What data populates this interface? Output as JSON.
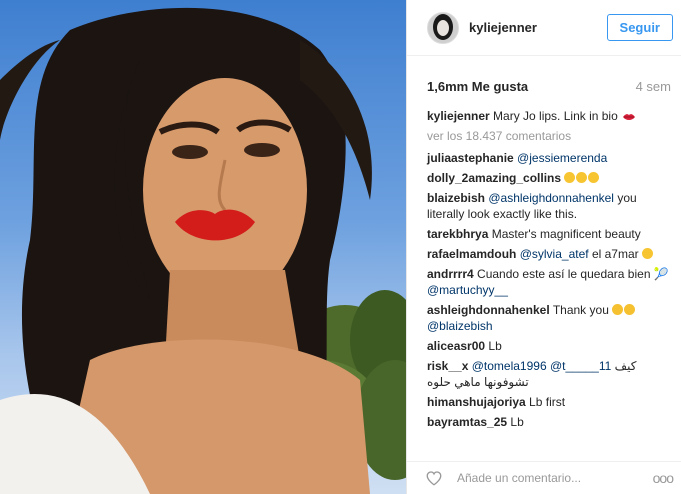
{
  "post": {
    "username": "kyliejenner",
    "follow_label": "Seguir",
    "likes": "1,6mm Me gusta",
    "age": "4 sem",
    "caption_user": "kyliejenner",
    "caption_text": "Mary Jo lips. Link in bio",
    "view_all": "ver los 18.437 comentarios"
  },
  "comments": [
    {
      "user": "juliaastephanie",
      "mention": "@jessiemerenda"
    },
    {
      "user": "dolly_2amazing_collins",
      "emoji_count": 3
    },
    {
      "user": "blaizebish",
      "mention": "@ashleighdonnahenkel",
      "text": "you literally look exactly like this."
    },
    {
      "user": "tarekbhrya",
      "text": "Master's magnificent beauty"
    },
    {
      "user": "rafaelmamdouh",
      "mention": "@sylvia_atef",
      "text": "el a7mar"
    },
    {
      "user": "andrrrr4",
      "text": "Cuando este así le quedara bien",
      "text2": "🎾",
      "mention": "@martuchyy__"
    },
    {
      "user": "ashleighdonnahenkel",
      "text": "Thank you",
      "mention": "@blaizebish"
    },
    {
      "user": "aliceasr00",
      "text": "Lb"
    },
    {
      "user": "risk__x",
      "mention": "@tomela1996",
      "mention2": "@t_____11",
      "text_ar": "كيف تشوفونها",
      "text_ar2": "ماهي حلوه"
    },
    {
      "user": "himanshujajoriya",
      "text": "Lb first"
    },
    {
      "user": "bayramtas_25",
      "text": "Lb"
    }
  ],
  "footer": {
    "comment_placeholder": "Añade un comentario...",
    "more_label": "ooo"
  },
  "icons": {
    "heart": "heart-icon",
    "more": "more-options-icon",
    "lips": "kiss-lips-icon"
  },
  "colors": {
    "accent": "#3897f0",
    "mention": "#003569",
    "muted": "#999999"
  }
}
